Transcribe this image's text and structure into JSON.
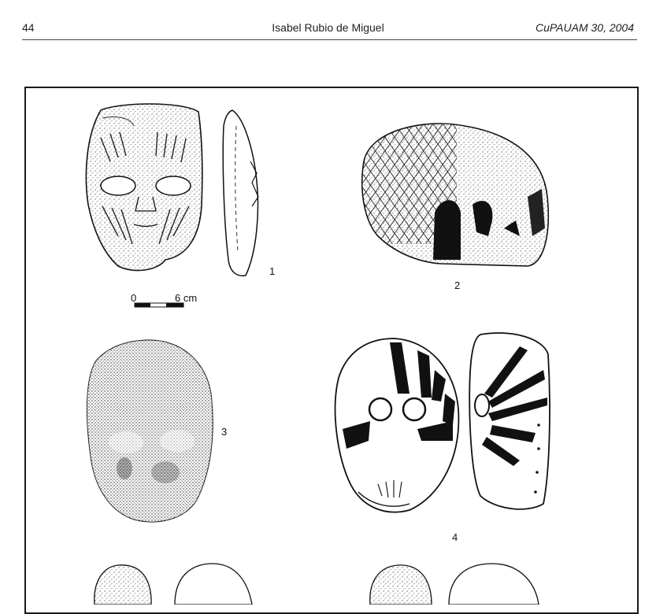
{
  "header": {
    "page_number": "44",
    "author": "Isabel Rubio de Miguel",
    "journal": "CuPAUAM 30, 2004"
  },
  "figure": {
    "labels": [
      "1",
      "2",
      "3",
      "4"
    ],
    "scale": {
      "start": "0",
      "end": "6 cm"
    }
  }
}
